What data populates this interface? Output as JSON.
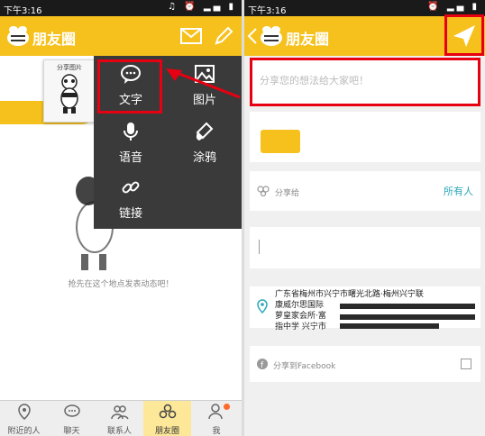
{
  "left": {
    "status": {
      "time": "下午3:16",
      "icons": "♫ ⏰ ▂▄ ▮"
    },
    "appbar": {
      "title": "朋友圈"
    },
    "share_thumb": {
      "label": "分享图片"
    },
    "popup": {
      "items": [
        {
          "label": "文字",
          "icon": "speech-bubble-icon"
        },
        {
          "label": "图片",
          "icon": "picture-icon"
        },
        {
          "label": "语音",
          "icon": "microphone-icon"
        },
        {
          "label": "涂鸦",
          "icon": "brush-icon"
        },
        {
          "label": "链接",
          "icon": "link-icon"
        }
      ]
    },
    "empty_text": "抢先在这个地点发表动态吧！",
    "nav": [
      {
        "label": "附近的人",
        "icon": "location-pin-icon"
      },
      {
        "label": "聊天",
        "icon": "chat-icon"
      },
      {
        "label": "联系人",
        "icon": "contacts-icon"
      },
      {
        "label": "朋友圈",
        "icon": "moments-icon"
      },
      {
        "label": "我",
        "icon": "person-icon"
      }
    ]
  },
  "right": {
    "status": {
      "time": "下午3:16",
      "icons": "⏰ ▂▄ ▮"
    },
    "appbar": {
      "title": "朋友圈"
    },
    "compose_placeholder": "分享您的想法给大家吧！",
    "audience": {
      "label": "分享给",
      "value": "所有人"
    },
    "location": {
      "address": "广东省梅州市兴宁市曙光北路·梅州兴宁联\n康威尔思国际\n萝皇家会所·富\n指中学 兴宁市"
    },
    "facebook": {
      "label": "分享到Facebook"
    }
  },
  "colors": {
    "brand": "#f6c11c",
    "highlight": "#e60012",
    "accent_teal": "#2aa6b8"
  }
}
